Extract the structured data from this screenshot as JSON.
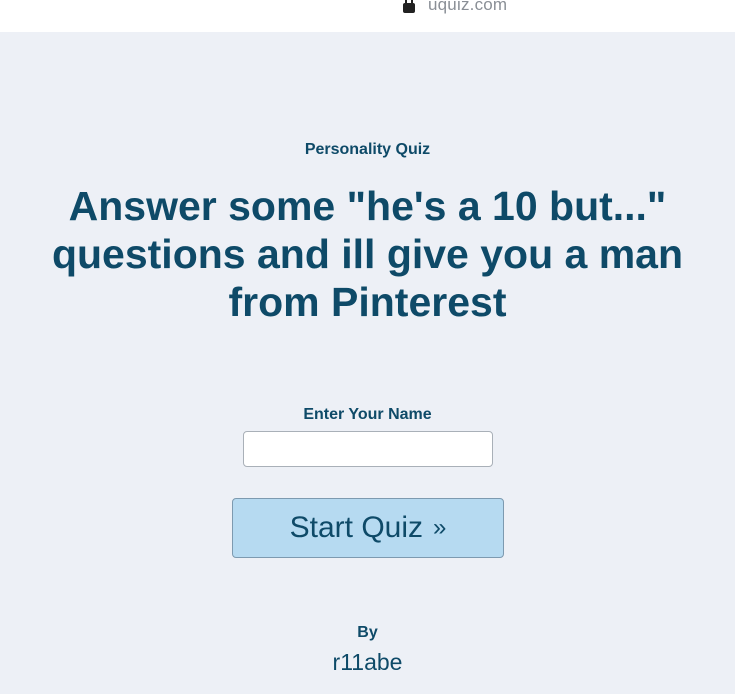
{
  "browser": {
    "url": "uquiz.com",
    "lock_icon": "lock-icon"
  },
  "quiz": {
    "category": "Personality Quiz",
    "title": "Answer some \"he's a 10 but...\" questions and ill give you a man from Pinterest",
    "name_label": "Enter Your Name",
    "name_value": "",
    "start_label": "Start Quiz",
    "start_chevron": "»",
    "by_label": "By",
    "author": "r11abe"
  },
  "colors": {
    "text_primary": "#0e4a68",
    "background": "#edf0f6",
    "button_bg": "#b6daf1"
  }
}
